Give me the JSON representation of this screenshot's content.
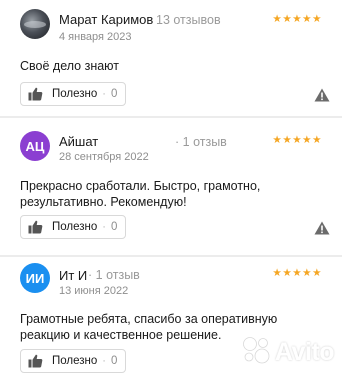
{
  "reviews": [
    {
      "author": "Марат Каримов",
      "reviews_count": "13 отзывов",
      "date": "4 января 2023",
      "stars": "★★★★★",
      "rating": 5,
      "text": "Своё дело знают",
      "useful_label": "Полезно",
      "useful_count": "0"
    },
    {
      "avatar_initials": "АЦ",
      "author": "Айшат",
      "reviews_count": "1 отзыв",
      "date": "28 сентября 2022",
      "stars": "★★★★★",
      "rating": 5,
      "text": "Прекрасно сработали. Быстро, грамотно, результативно. Рекомендую!",
      "useful_label": "Полезно",
      "useful_count": "0"
    },
    {
      "avatar_initials": "ИИ",
      "author": "Ит И",
      "reviews_count": "1 отзыв",
      "date": "13 июня 2022",
      "stars": "★★★★★",
      "rating": 5,
      "text": "Грамотные ребята, спасибо за оперативную реакцию и качественное решение.",
      "useful_label": "Полезно",
      "useful_count": "0"
    }
  ],
  "watermark": "Avito",
  "colors": {
    "star": "#f5a623",
    "avatar_purple": "#8b3fd1",
    "avatar_blue": "#1a8ff0",
    "muted_text": "#9a9a9a"
  },
  "icons": {
    "useful": "thumbs-up-icon",
    "report": "warning-triangle-icon",
    "watermark": "avito-logo-icon"
  }
}
